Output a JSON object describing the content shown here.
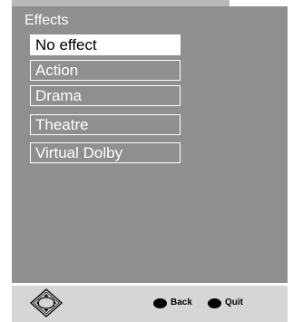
{
  "menu": {
    "title": "Effects",
    "items": [
      "No effect",
      "Action",
      "Drama",
      "Theatre",
      "Virtual Dolby"
    ],
    "selected_index": 0
  },
  "footer": {
    "nav_icon": "navigation-pad-icon",
    "back": {
      "label": "Back",
      "icon": "black-dot-icon"
    },
    "quit": {
      "label": "Quit",
      "icon": "black-dot-icon"
    }
  },
  "colors": {
    "panel": "#8f8f8f",
    "footer": "#d6d6d6",
    "highlight": "#ffffff",
    "text": "#ffffff"
  }
}
